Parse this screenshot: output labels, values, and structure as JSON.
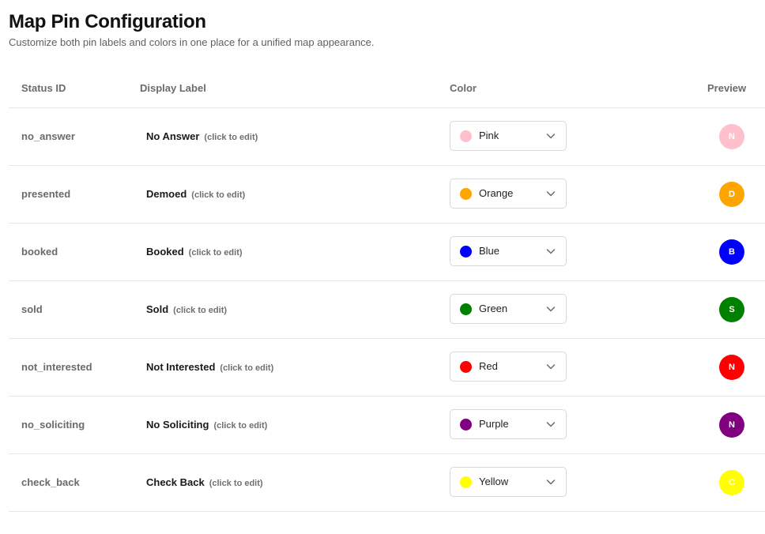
{
  "page": {
    "title": "Map Pin Configuration",
    "subtitle": "Customize both pin labels and colors in one place for a unified map appearance."
  },
  "table": {
    "headers": {
      "status_id": "Status ID",
      "display_label": "Display Label",
      "color": "Color",
      "preview": "Preview"
    },
    "edit_hint": "(click to edit)",
    "rows": [
      {
        "status_id": "no_answer",
        "label": "No Answer",
        "color_name": "Pink",
        "color_hex": "#ffc0cb",
        "initial": "N"
      },
      {
        "status_id": "presented",
        "label": "Demoed",
        "color_name": "Orange",
        "color_hex": "#ffa500",
        "initial": "D"
      },
      {
        "status_id": "booked",
        "label": "Booked",
        "color_name": "Blue",
        "color_hex": "#0000ff",
        "initial": "B"
      },
      {
        "status_id": "sold",
        "label": "Sold",
        "color_name": "Green",
        "color_hex": "#008000",
        "initial": "S"
      },
      {
        "status_id": "not_interested",
        "label": "Not Interested",
        "color_name": "Red",
        "color_hex": "#ff0000",
        "initial": "N"
      },
      {
        "status_id": "no_soliciting",
        "label": "No Soliciting",
        "color_name": "Purple",
        "color_hex": "#800080",
        "initial": "N"
      },
      {
        "status_id": "check_back",
        "label": "Check Back",
        "color_name": "Yellow",
        "color_hex": "#ffff00",
        "initial": "C"
      }
    ]
  },
  "icons": {
    "dropdown": "chevron-down-icon"
  }
}
